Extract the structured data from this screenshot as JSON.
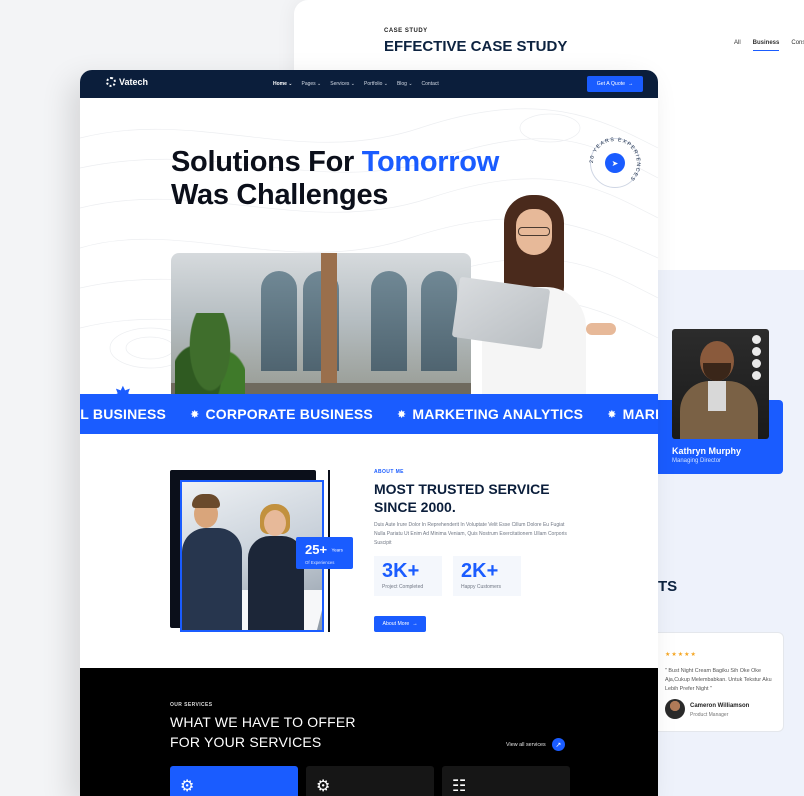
{
  "background_page": {
    "eyebrow": "CASE STUDY",
    "title": "EFFECTIVE CASE STUDY",
    "filters": [
      {
        "label": "All",
        "active": false
      },
      {
        "label": "Business",
        "active": true
      },
      {
        "label": "Consul",
        "active": false
      }
    ],
    "team": {
      "name": "Kathryn Murphy",
      "role": "Managing Director",
      "social_icons": [
        "instagram-icon",
        "facebook-icon",
        "twitter-icon",
        "pinterest-icon"
      ]
    },
    "partial_heading": "TS",
    "testimonial": {
      "stars": "★★★★★",
      "quote": "\" Bust Night Cream Bagiku Sih Oke Oke Aja,Cukup Melembabkan. Untuk Tekstur Aku Lebih Prefer Night \"",
      "name": "Cameron Williamson",
      "role": "Product Manager"
    }
  },
  "nav": {
    "logo": "Vatech",
    "menu": [
      {
        "label": "Home ⌄",
        "active": true
      },
      {
        "label": "Pages ⌄",
        "active": false
      },
      {
        "label": "Services ⌄",
        "active": false
      },
      {
        "label": "Portfolio ⌄",
        "active": false
      },
      {
        "label": "Blog ⌄",
        "active": false
      },
      {
        "label": "Contact",
        "active": false
      }
    ],
    "cta": "Get A Quote",
    "cta_icon": "arrow-right-icon"
  },
  "hero": {
    "title_line1_plain": "Solutions For ",
    "title_line1_accent": "Tomorrow",
    "title_line2": "Was Challenges",
    "badge_text": "20 YEARS EXPERIENCES",
    "badge_icon": "paper-plane-icon"
  },
  "marquee": {
    "items": [
      "AL BUSINESS",
      "CORPORATE BUSINESS",
      "MARKETING ANALYTICS",
      "MARKE"
    ]
  },
  "about": {
    "experience_number": "25+",
    "experience_unit": "Years",
    "experience_label": "Of Experiences",
    "eyebrow": "ABOUT ME",
    "title": "MOST TRUSTED SERVICE SINCE 2000.",
    "paragraph": "Duis Aute Irure Dolor In Reprehenderit In Voluptate Velit Esse Cillum Dolore Eu Fugiat Nulla Pariatu Ut Enim Ad Minima Veniam, Quis Nostrum Exercitationem Ullam Corporis Suscipit",
    "stats": [
      {
        "value": "3K+",
        "label": "Project Completed"
      },
      {
        "value": "2K+",
        "label": "Happy Customers"
      }
    ],
    "button": "About More"
  },
  "services": {
    "eyebrow": "OUR SERVICES",
    "title_line1": "WHAT WE HAVE TO OFFER",
    "title_line2": "FOR YOUR SERVICES",
    "view_all": "View all services",
    "cards": [
      {
        "icon": "gear-code-icon",
        "active": true
      },
      {
        "icon": "settings-flow-icon",
        "active": false
      },
      {
        "icon": "database-icon",
        "active": false
      }
    ]
  },
  "colors": {
    "accent": "#1a5cff",
    "navy": "#0b1e3b",
    "black": "#000000"
  }
}
